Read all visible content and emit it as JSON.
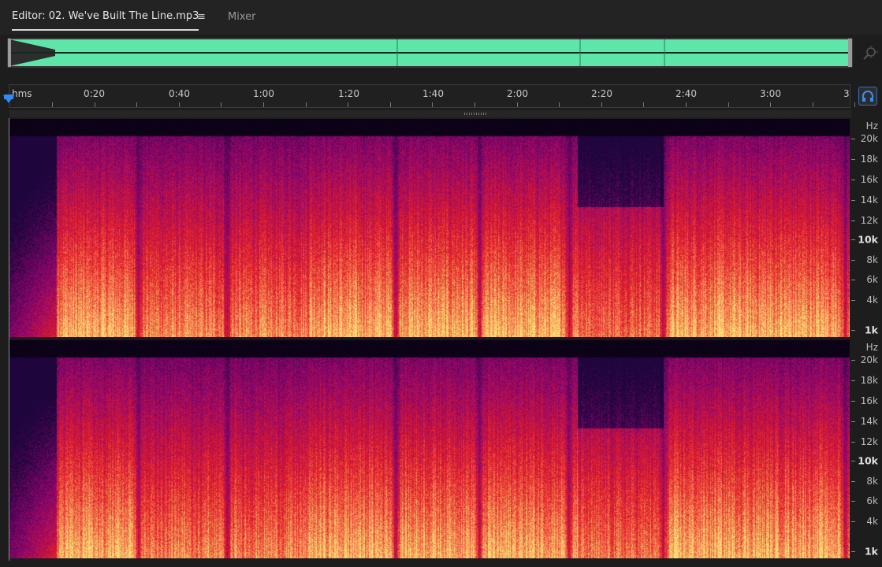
{
  "tabs": {
    "editor_label": "Editor: 02. We've Built The Line.mp3",
    "menu_icon": "≡",
    "mixer_label": "Mixer"
  },
  "ruler": {
    "unit_label": "hms",
    "time_labels": [
      "0:20",
      "0:40",
      "1:00",
      "1:20",
      "1:40",
      "2:00",
      "2:20",
      "2:40",
      "3:00",
      "3"
    ]
  },
  "frequency_axis": {
    "unit_label": "Hz",
    "labels": [
      "20k",
      "18k",
      "16k",
      "14k",
      "12k",
      "10k",
      "8k",
      "6k",
      "4k",
      "1k"
    ],
    "major_labels": [
      "10k",
      "1k"
    ]
  },
  "colors": {
    "waveform": "#5ee6a8",
    "playhead": "#2f8bf5",
    "spectrogram_low": "#1a0630",
    "spectrogram_mid": "#c8143c",
    "spectrogram_high": "#ffe27a"
  },
  "icons": {
    "zoom": "zoom-icon",
    "monitor": "headphones-icon",
    "playhead": "playhead-marker-icon"
  }
}
